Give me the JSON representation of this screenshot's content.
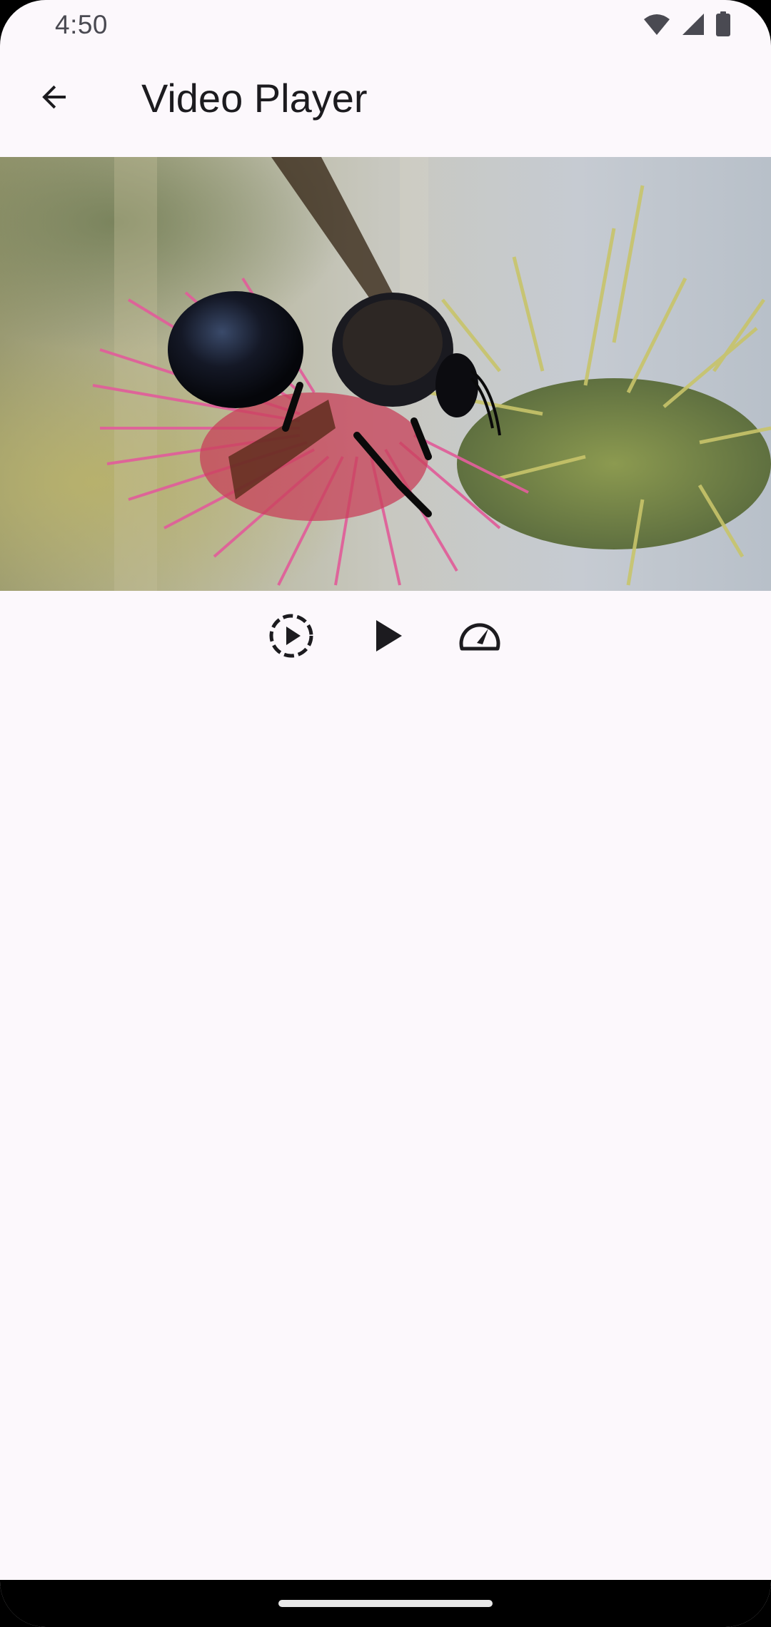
{
  "status_bar": {
    "time": "4:50",
    "icons": [
      "wifi-icon",
      "cellular-signal-icon",
      "battery-icon"
    ]
  },
  "app_bar": {
    "back_icon": "arrow-back-icon",
    "title": "Video Player"
  },
  "video": {
    "content": "bee-on-thistle-frame"
  },
  "controls": [
    {
      "name": "replay-icon"
    },
    {
      "name": "play-icon"
    },
    {
      "name": "speed-icon"
    }
  ],
  "colors": {
    "background": "#fcf8fc",
    "icon": "#1c1b1f",
    "status_text": "#4a4a52"
  }
}
